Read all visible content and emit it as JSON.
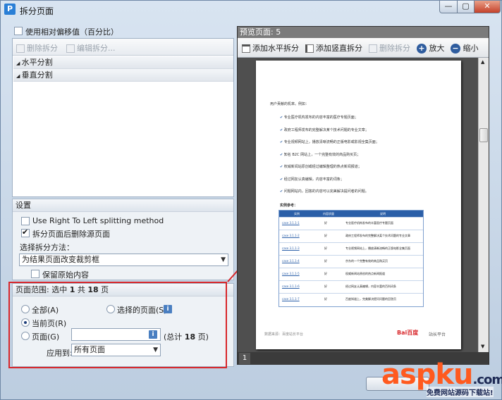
{
  "window": {
    "title": "拆分页面",
    "app_icon_letter": "P"
  },
  "left": {
    "use_relative_offset_label": "使用相对偏移值（百分比）",
    "toolbar": {
      "delete_split": "删除拆分",
      "edit_split": "编辑拆分..."
    },
    "tree": {
      "horizontal": "水平分割",
      "vertical": "垂直分割"
    }
  },
  "settings": {
    "title": "设置",
    "rtl_label": "Use Right To Left splitting method",
    "delete_source_label": "拆分页面后删除源页面",
    "method_label": "选择拆分方法：",
    "method_value": "为结果页面改变裁剪框",
    "keep_original_label": "保留原始内容"
  },
  "range": {
    "title_prefix": "页面范围: 选中",
    "selected": "1",
    "mid": "共",
    "total": "18",
    "suffix": "页",
    "all_label": "全部(A)",
    "selected_pages_label": "选择的页面(S)",
    "current_label": "当前页(R)",
    "pages_label": "页面(G)",
    "total_label_prefix": "(总计",
    "total_count": "18",
    "total_label_suffix": "页)",
    "apply_to_label": "应用到:",
    "apply_to_value": "所有页面"
  },
  "preview": {
    "title": "预览页面: 5",
    "add_horizontal": "添加水平拆分",
    "add_vertical": "添加竖直拆分",
    "delete_split": "删除拆分",
    "zoom_in": "放大",
    "zoom_out": "缩小",
    "page_number": "1"
  },
  "doc": {
    "intro": "用户贡献的机率。例如：",
    "bullets": [
      "专业医疗机构发布的内容丰富的医疗专题页面；",
      "政府工程师发布的完整解决某个技术问题的专业文章；",
      "专业视频网站上，播放清晰流畅的正版电影或影视全集页面；",
      "知名 B2C 网站上，一个完整有效的商品购买页；",
      "权威新闻站原创或经过编辑整理的热点新闻报道；",
      "经过网友认真编辑，内容丰富的词条；",
      "问题网站内，回答的内容可以完美解决提问者的问题。"
    ],
    "example_title": "实例参考：",
    "table_headers": [
      "实例",
      "内容质量",
      "说明"
    ],
    "rows": [
      {
        "id": "case 3.1.1-1",
        "q": "好",
        "d": "专业医疗机构发布的丰富医疗专题页面"
      },
      {
        "id": "case 3.1.1-2",
        "q": "好",
        "d": "政府工程师发布的完整解决某个技术问题的专业文章"
      },
      {
        "id": "case 3.1.1-3",
        "q": "好",
        "d": "专业视频网站上，播放清晰流畅的正版电影全集页面"
      },
      {
        "id": "case 3.1.1-4",
        "q": "好",
        "d": "京东的一个完整有效的商品购买页"
      },
      {
        "id": "case 3.1.1-5",
        "q": "好",
        "d": "权威新闻站原创的热点新闻报道"
      },
      {
        "id": "case 3.1.1-6",
        "q": "好",
        "d": "经过网友认真编辑，内容丰富的百科词条"
      },
      {
        "id": "case 3.1.1-7",
        "q": "好",
        "d": "百度知道上，完美解决提问问题的回答页"
      }
    ],
    "footer_left": "数据来源：百度站长平台",
    "footer_logo": "Bai百度",
    "footer_right": "站长平台"
  },
  "watermark": {
    "text": "aspku",
    "suffix": ".com",
    "sub": "免费网站源码下载站!"
  }
}
